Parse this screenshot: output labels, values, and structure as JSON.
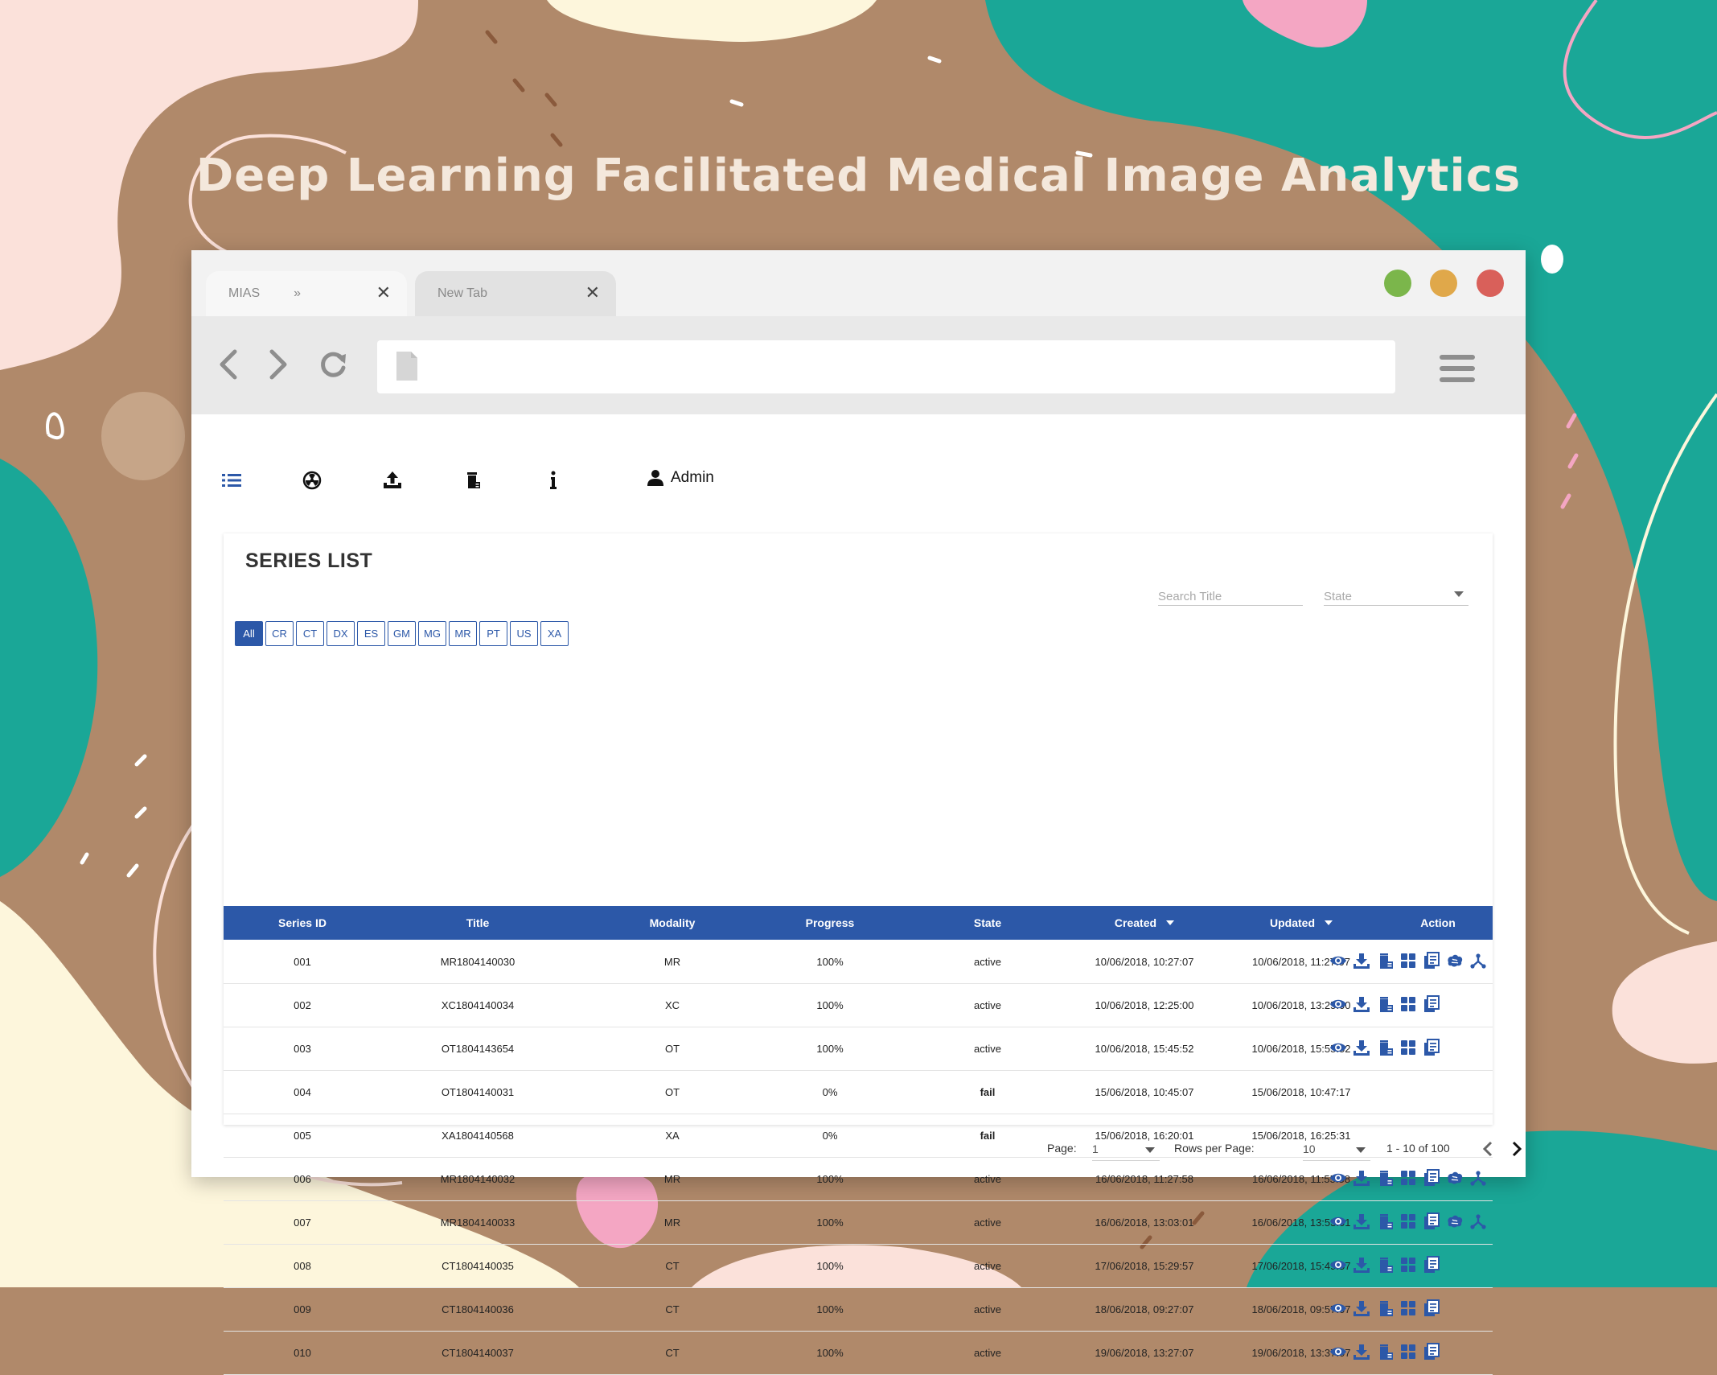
{
  "headline": "Deep Learning Facilitated Medical Image Analytics",
  "browser": {
    "tabs": [
      {
        "label": "MIAS",
        "extra": "»"
      },
      {
        "label": "New Tab",
        "extra": ""
      }
    ],
    "window_controls": {
      "green": "#7bb64b",
      "yellow": "#e0a84a",
      "red": "#d9605a"
    }
  },
  "app_nav": {
    "icons": [
      "list-icon",
      "radiation-icon",
      "upload-icon",
      "trash-icon",
      "info-icon"
    ],
    "user_label": "Admin"
  },
  "series_list": {
    "title": "SERIES LIST",
    "search_placeholder": "Search Title",
    "state_placeholder": "State",
    "filters": [
      "All",
      "CR",
      "CT",
      "DX",
      "ES",
      "GM",
      "MG",
      "MR",
      "PT",
      "US",
      "XA"
    ],
    "active_filter": "All",
    "columns": [
      "Series ID",
      "Title",
      "Modality",
      "Progress",
      "State",
      "Created",
      "Updated",
      "Action"
    ],
    "rows": [
      {
        "id": "001",
        "title": "MR1804140030",
        "modality": "MR",
        "progress": "100%",
        "state": "active",
        "created": "10/06/2018, 10:27:07",
        "updated": "10/06/2018, 11:27:07",
        "actions": [
          "view-icon",
          "download-icon",
          "delete-icon",
          "grid-icon",
          "report-icon",
          "brain-icon",
          "network-icon"
        ]
      },
      {
        "id": "002",
        "title": "XC1804140034",
        "modality": "XC",
        "progress": "100%",
        "state": "active",
        "created": "10/06/2018, 12:25:00",
        "updated": "10/06/2018, 13:25:00",
        "actions": [
          "view-icon",
          "download-icon",
          "delete-icon",
          "grid-icon",
          "report-icon"
        ]
      },
      {
        "id": "003",
        "title": "OT1804143654",
        "modality": "OT",
        "progress": "100%",
        "state": "active",
        "created": "10/06/2018, 15:45:52",
        "updated": "10/06/2018, 15:55:52",
        "actions": [
          "view-icon",
          "download-icon",
          "delete-icon",
          "grid-icon",
          "report-icon"
        ]
      },
      {
        "id": "004",
        "title": "OT1804140031",
        "modality": "OT",
        "progress": "0%",
        "state": "fail",
        "created": "15/06/2018, 10:45:07",
        "updated": "15/06/2018, 10:47:17",
        "actions": []
      },
      {
        "id": "005",
        "title": "XA1804140568",
        "modality": "XA",
        "progress": "0%",
        "state": "fail",
        "created": "15/06/2018, 16:20:01",
        "updated": "15/06/2018, 16:25:31",
        "actions": []
      },
      {
        "id": "006",
        "title": "MR1804140032",
        "modality": "MR",
        "progress": "100%",
        "state": "active",
        "created": "16/06/2018, 11:27:58",
        "updated": "16/06/2018, 11:55:58",
        "actions": [
          "view-icon",
          "download-icon",
          "delete-icon",
          "grid-icon",
          "report-icon",
          "brain-icon",
          "network-icon"
        ]
      },
      {
        "id": "007",
        "title": "MR1804140033",
        "modality": "MR",
        "progress": "100%",
        "state": "active",
        "created": "16/06/2018, 13:03:01",
        "updated": "16/06/2018, 13:53:01",
        "actions": [
          "view-icon",
          "download-icon",
          "delete-icon",
          "grid-icon",
          "report-icon",
          "brain-icon",
          "network-icon"
        ]
      },
      {
        "id": "008",
        "title": "CT1804140035",
        "modality": "CT",
        "progress": "100%",
        "state": "active",
        "created": "17/06/2018, 15:29:57",
        "updated": "17/06/2018, 15:49:57",
        "actions": [
          "view-icon",
          "download-icon",
          "delete-icon",
          "grid-icon",
          "report-icon"
        ]
      },
      {
        "id": "009",
        "title": "CT1804140036",
        "modality": "CT",
        "progress": "100%",
        "state": "active",
        "created": "18/06/2018, 09:27:07",
        "updated": "18/06/2018, 09:57:07",
        "actions": [
          "view-icon",
          "download-icon",
          "delete-icon",
          "grid-icon",
          "report-icon"
        ]
      },
      {
        "id": "010",
        "title": "CT1804140037",
        "modality": "CT",
        "progress": "100%",
        "state": "active",
        "created": "19/06/2018, 13:27:07",
        "updated": "19/06/2018, 13:37:07",
        "actions": [
          "view-icon",
          "download-icon",
          "delete-icon",
          "grid-icon",
          "report-icon"
        ]
      }
    ]
  },
  "pagination": {
    "page_label": "Page:",
    "page_value": "1",
    "rows_label": "Rows per Page:",
    "rows_value": "10",
    "range_text": "1 - 10 of 100"
  },
  "colors": {
    "accent": "#2c58a8",
    "background_brown": "#b0896a",
    "teal": "#1aa797",
    "pink": "#f4a6c3",
    "cream": "#fdf6dc",
    "blush": "#fbe1da"
  }
}
